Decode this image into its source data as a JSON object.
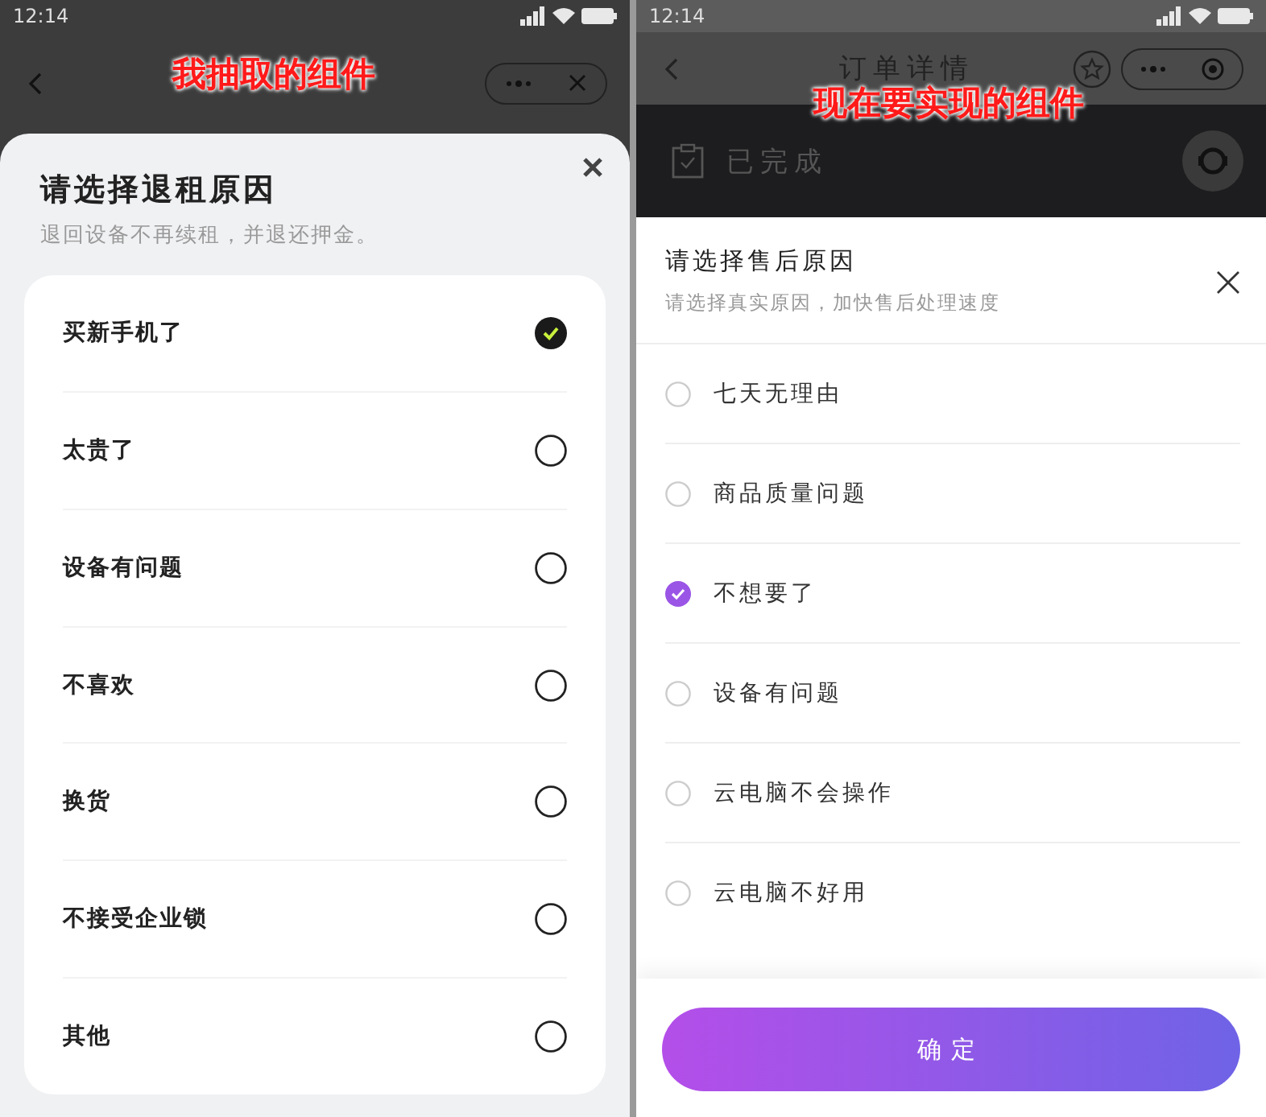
{
  "left": {
    "status_bar": {
      "time": "12:14"
    },
    "caption": "我抽取的组件",
    "sheet": {
      "title": "请选择退租原因",
      "subtitle": "退回设备不再续租，并退还押金。",
      "options": [
        {
          "label": "买新手机了",
          "selected": true
        },
        {
          "label": "太贵了",
          "selected": false
        },
        {
          "label": "设备有问题",
          "selected": false
        },
        {
          "label": "不喜欢",
          "selected": false
        },
        {
          "label": "换货",
          "selected": false
        },
        {
          "label": "不接受企业锁",
          "selected": false
        },
        {
          "label": "其他",
          "selected": false
        }
      ]
    }
  },
  "right": {
    "status_bar": {
      "time": "12:14"
    },
    "nav": {
      "title": "订单详情"
    },
    "order_status": "已完成",
    "caption": "现在要实现的组件",
    "sheet": {
      "title": "请选择售后原因",
      "subtitle": "请选择真实原因，加快售后处理速度",
      "options": [
        {
          "label": "七天无理由",
          "selected": false
        },
        {
          "label": "商品质量问题",
          "selected": false
        },
        {
          "label": "不想要了",
          "selected": true
        },
        {
          "label": "设备有问题",
          "selected": false
        },
        {
          "label": "云电脑不会操作",
          "selected": false
        },
        {
          "label": "云电脑不好用",
          "selected": false
        }
      ],
      "confirm": "确定"
    }
  }
}
